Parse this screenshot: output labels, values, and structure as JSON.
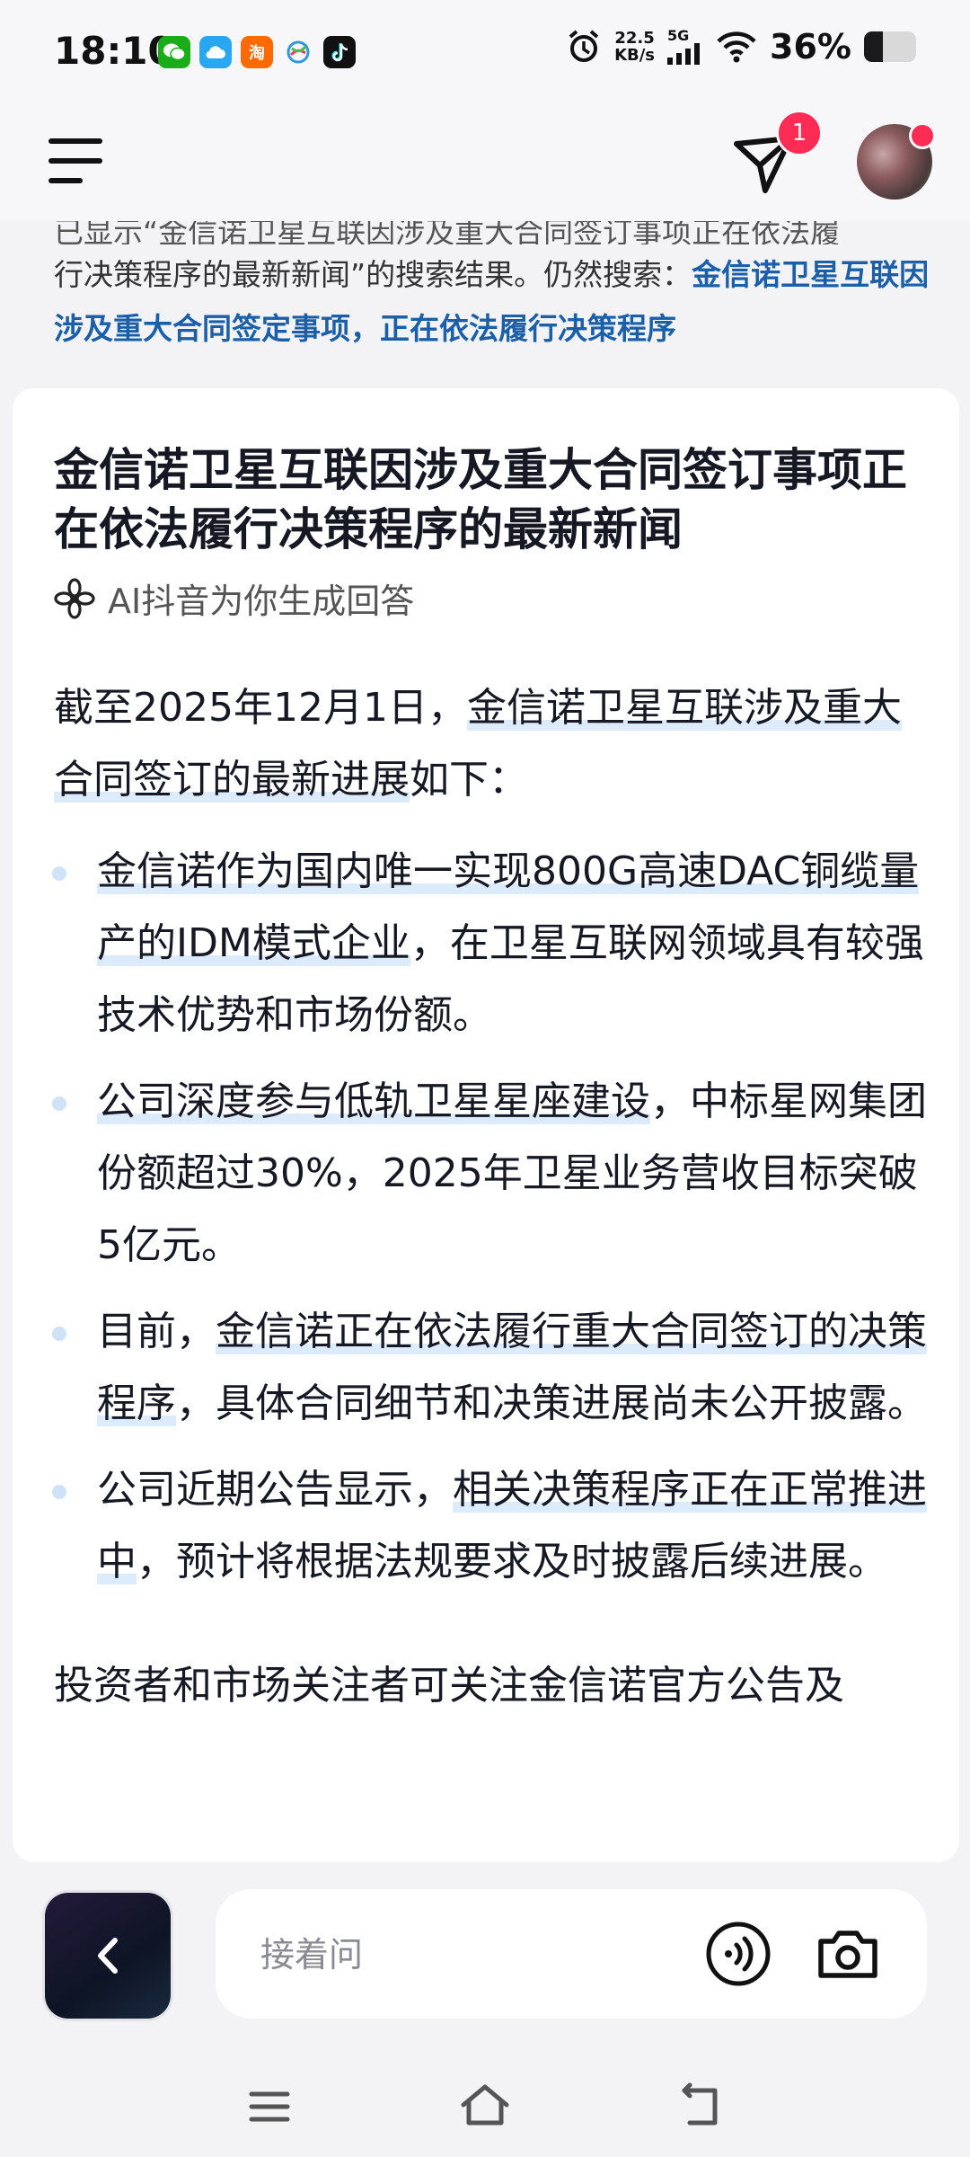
{
  "status_bar": {
    "time": "18:10",
    "apps": [
      "wechat-icon",
      "cloud-app-icon",
      "taobao-icon",
      "mobile-network-icon",
      "tiktok-icon"
    ],
    "taobao_label": "淘",
    "net_speed_value": "22.5",
    "net_speed_unit": "KB/s",
    "network": "5G",
    "battery_percent": "36%",
    "battery_level": 0.36
  },
  "header": {
    "notification_count": "1",
    "accent_color": "#fe2c55"
  },
  "snippet": {
    "line1_partial": "已显示“金信诺卫星互联因涉及重大合同签订事项正在依法履",
    "line2_prefix": "行决策程序的最新新闻”的搜索结果。仍然搜索：",
    "search_link": "金信诺卫星互联因涉及重大合同签定事项，正在依法履行决策程序"
  },
  "card": {
    "title": "金信诺卫星互联因涉及重大合同签订事项正在依法履行决策程序的最新新闻",
    "ai_label": "AI抖音为你生成回答",
    "intro_prefix": "截至2025年12月1日，",
    "intro_highlight": "金信诺卫星互联涉及重大合同签订的最新进展",
    "intro_suffix": "如下：",
    "bullets": [
      {
        "prefix": "",
        "highlight": "金信诺作为国内唯一实现800G高速DAC铜缆量产的IDM模式企业",
        "suffix": "，在卫星互联网领域具有较强技术优势和市场份额。"
      },
      {
        "prefix": "",
        "highlight": "公司深度参与低轨卫星星座建设",
        "suffix": "，中标星网集团份额超过30%，2025年卫星业务营收目标突破5亿元。"
      },
      {
        "prefix": "目前，",
        "highlight": "金信诺正在依法履行重大合同签订的决策程序",
        "suffix": "，具体合同细节和决策进展尚未公开披露。"
      },
      {
        "prefix": "公司近期公告显示，",
        "highlight": "相关决策程序正在正常推进中",
        "suffix": "，预计将根据法规要求及时披露后续进展。"
      }
    ],
    "closing": "投资者和市场关注者可关注金信诺官方公告及"
  },
  "input_bar": {
    "placeholder": "接着问"
  }
}
